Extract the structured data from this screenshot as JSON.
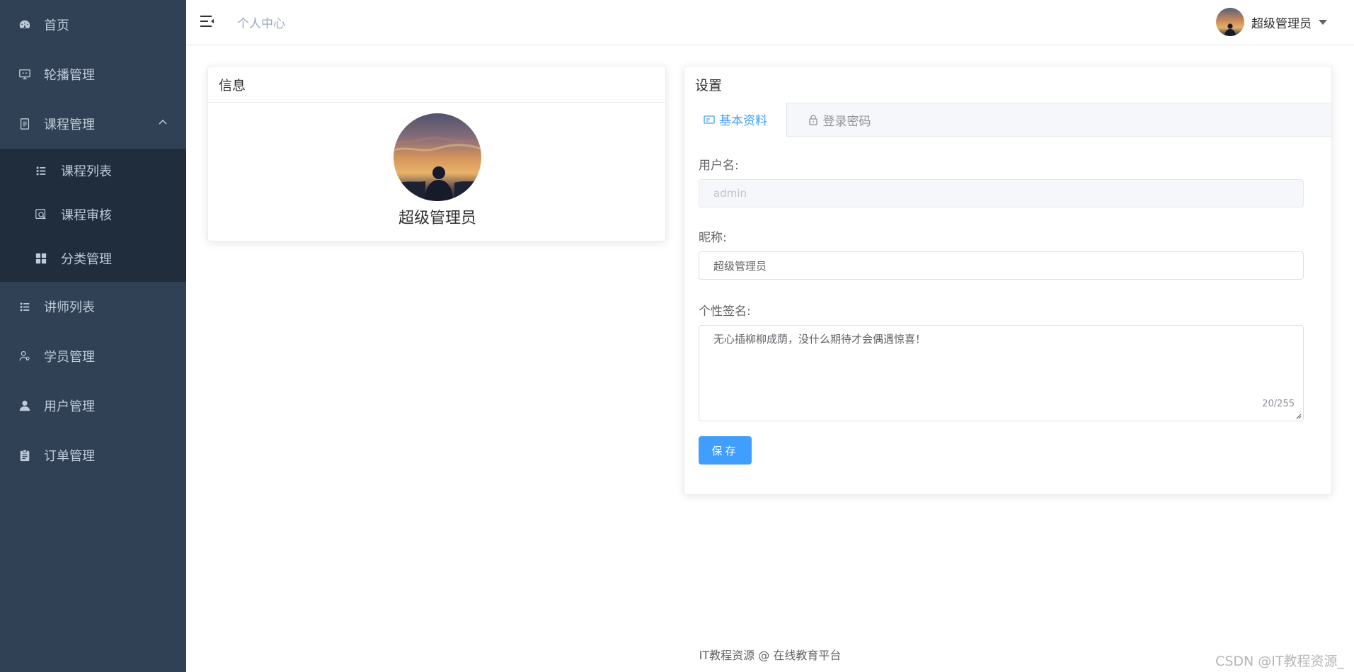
{
  "sidebar": {
    "items": [
      {
        "label": "首页",
        "icon": "dashboard-icon"
      },
      {
        "label": "轮播管理",
        "icon": "monitor-icon"
      },
      {
        "label": "课程管理",
        "icon": "document-icon",
        "expanded": true
      },
      {
        "label": "讲师列表",
        "icon": "list-icon"
      },
      {
        "label": "学员管理",
        "icon": "people-icon"
      },
      {
        "label": "用户管理",
        "icon": "user-icon"
      },
      {
        "label": "订单管理",
        "icon": "clipboard-icon"
      }
    ],
    "submenu": [
      {
        "label": "课程列表",
        "icon": "list-icon"
      },
      {
        "label": "课程审核",
        "icon": "search-doc-icon"
      },
      {
        "label": "分类管理",
        "icon": "grid-icon"
      }
    ]
  },
  "header": {
    "breadcrumb": "个人中心",
    "user_name": "超级管理员"
  },
  "info_card": {
    "title": "信息",
    "name": "超级管理员"
  },
  "settings_card": {
    "title": "设置",
    "tabs": [
      {
        "label": "基本资料",
        "icon": "id-card-icon",
        "active": true
      },
      {
        "label": "登录密码",
        "icon": "lock-icon",
        "active": false
      }
    ],
    "form": {
      "username_label": "用户名:",
      "username_value": "admin",
      "nickname_label": "昵称:",
      "nickname_value": "超级管理员",
      "signature_label": "个性签名:",
      "signature_value": "无心插柳柳成荫，没什么期待才会偶遇惊喜！",
      "signature_count": "20/255",
      "save_label": "保存"
    }
  },
  "footer": {
    "text": "IT教程资源 @ 在线教育平台"
  },
  "watermark": "CSDN @IT教程资源_",
  "colors": {
    "sidebar_bg": "#304156",
    "submenu_bg": "#1f2d3d",
    "sidebar_text": "#bfcbd9",
    "primary": "#409eff"
  }
}
